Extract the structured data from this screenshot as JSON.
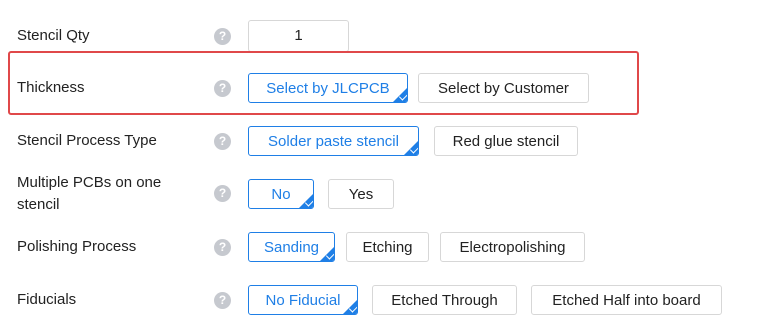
{
  "rows": {
    "stencil_qty": {
      "label": "Stencil Qty",
      "help": "?",
      "value": "1"
    },
    "thickness": {
      "label": "Thickness",
      "help": "?",
      "options": [
        "Select by JLCPCB",
        "Select by Customer"
      ],
      "selected": "Select by JLCPCB"
    },
    "process_type": {
      "label": "Stencil Process Type",
      "help": "?",
      "options": [
        "Solder paste stencil",
        "Red glue stencil"
      ],
      "selected": "Solder paste stencil"
    },
    "multiple_pcbs": {
      "label": "Multiple PCBs on one stencil",
      "help": "?",
      "options": [
        "No",
        "Yes"
      ],
      "selected": "No"
    },
    "polishing": {
      "label": "Polishing Process",
      "help": "?",
      "options": [
        "Sanding",
        "Etching",
        "Electropolishing"
      ],
      "selected": "Sanding"
    },
    "fiducials": {
      "label": "Fiducials",
      "help": "?",
      "options": [
        "No Fiducial",
        "Etched Through",
        "Etched Half into board"
      ],
      "selected": "No Fiducial"
    }
  },
  "colors": {
    "accent": "#1f7fe6",
    "highlight_border": "#e0484a",
    "help_icon": "#c6c9cf"
  }
}
